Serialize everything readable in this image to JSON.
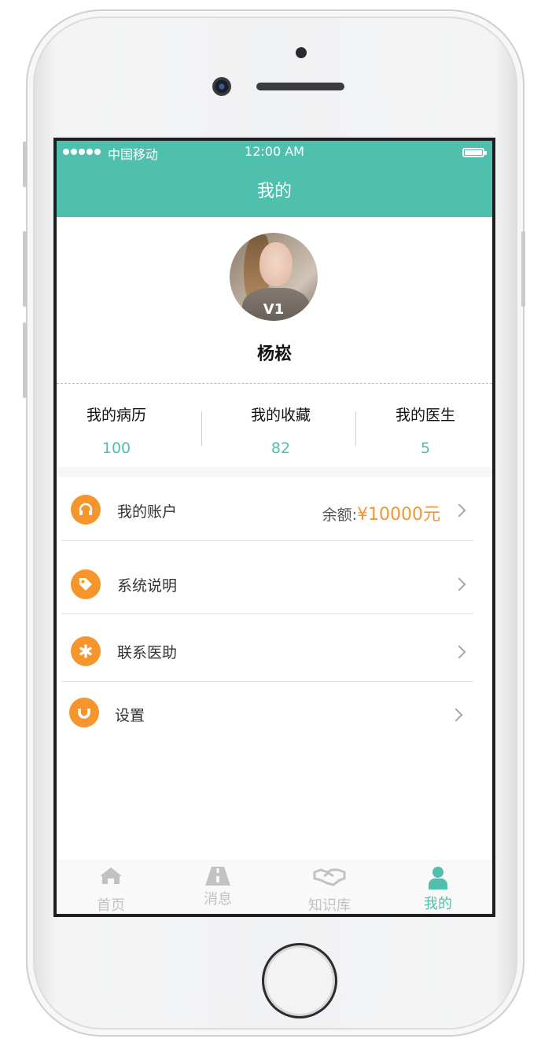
{
  "status_bar": {
    "carrier": "中国移动",
    "time": "12:00 AM"
  },
  "header": {
    "title": "我的"
  },
  "profile": {
    "vip_badge": "V1",
    "name": "杨崧"
  },
  "stats": [
    {
      "label": "我的病历",
      "value": "100"
    },
    {
      "label": "我的收藏",
      "value": "82"
    },
    {
      "label": "我的医生",
      "value": "5"
    }
  ],
  "menu": {
    "account": {
      "label": "我的账户",
      "balance_label": "余额:",
      "balance_value": "¥10000元",
      "icon": "headphones-icon"
    },
    "about": {
      "label": "系统说明",
      "icon": "tag-icon"
    },
    "contact": {
      "label": "联系医助",
      "icon": "asterisk-icon"
    },
    "settings": {
      "label": "设置",
      "icon": "magnet-icon"
    }
  },
  "tabs": [
    {
      "label": "首页",
      "icon": "home-icon",
      "active": false
    },
    {
      "label": "消息",
      "icon": "road-icon",
      "active": false
    },
    {
      "label": "知识库",
      "icon": "handshake-icon",
      "active": false
    },
    {
      "label": "我的",
      "icon": "user-icon",
      "active": true
    }
  ],
  "colors": {
    "accent": "#4fc0ad",
    "orange": "#f7952d"
  }
}
